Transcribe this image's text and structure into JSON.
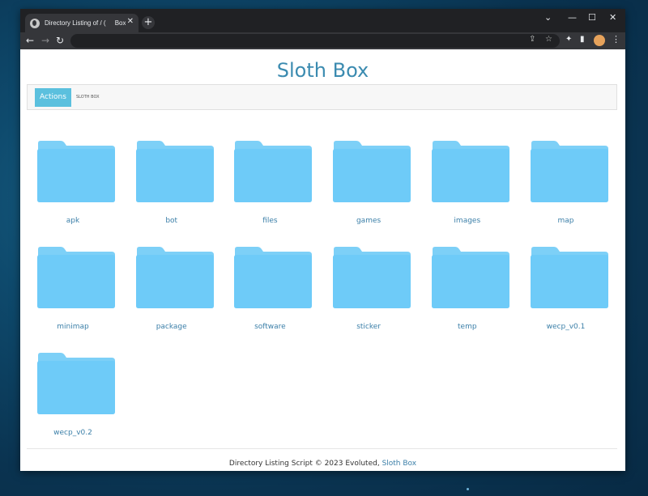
{
  "browser": {
    "tab_title": "Directory Listing of / (     Box)",
    "tab_close": "✕",
    "new_tab": "+",
    "window_controls": {
      "minimize": "—",
      "maximize": "☐",
      "close": "✕",
      "dropdown": "⌄"
    },
    "nav": {
      "back": "←",
      "forward": "→",
      "reload": "↻"
    },
    "omnibox_icons": {
      "share": "⇪",
      "bookmark": "☆"
    },
    "toolbar_icons": {
      "extensions": "✦",
      "sidepanel": "▮",
      "menu": "⋮"
    }
  },
  "site": {
    "title": "Sloth Box",
    "actions_label": "Actions",
    "brand_label": "SLOTH BOX"
  },
  "folders": [
    "apk",
    "bot",
    "files",
    "games",
    "images",
    "map",
    "minimap",
    "package",
    "software",
    "sticker",
    "temp",
    "wecp_v0.1",
    "wecp_v0.2"
  ],
  "footer": {
    "text": "Directory Listing Script © 2023 Evoluted, ",
    "link": "Sloth Box"
  },
  "colors": {
    "folder_back": "#7dd0f7",
    "folder_front": "#6ecbf8",
    "accent": "#3b8bb0",
    "actions_bg": "#5bc0de"
  }
}
